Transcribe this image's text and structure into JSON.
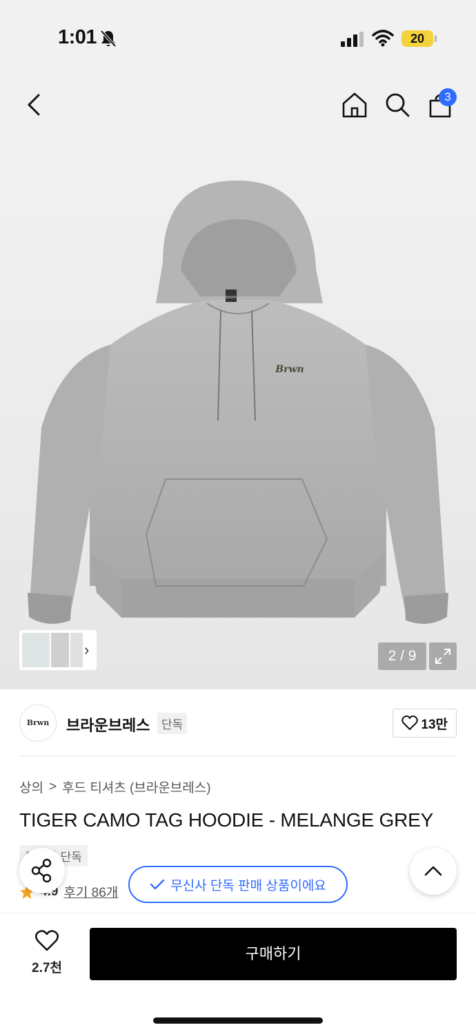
{
  "status_bar": {
    "time": "1:01",
    "battery": "20"
  },
  "nav": {
    "cart_count": "3"
  },
  "gallery": {
    "page_indicator": "2 / 9",
    "hoodie_tag_text": "BRWN",
    "hoodie_logo_text": "Brwn"
  },
  "brand": {
    "logo_text": "Brwn",
    "name": "브라운브레스",
    "tag": "단독",
    "likes": "13만"
  },
  "breadcrumb": {
    "category": "상의",
    "separator": ">",
    "subcategory": "후드 티셔츠 (브라운브레스)"
  },
  "product": {
    "title": "TIGER CAMO TAG HOODIE - MELANGE GREY",
    "exclusive_tag": "무신사 단독",
    "rating": "4.9",
    "reviews": "후기 86개"
  },
  "toast": {
    "text": "무신사 단독 판매 상품이에요"
  },
  "bottom_bar": {
    "wish_count": "2.7천",
    "buy_label": "구매하기"
  },
  "colors": {
    "accent": "#2f6bff",
    "buy_button": "#000000",
    "star": "#f5a623"
  }
}
